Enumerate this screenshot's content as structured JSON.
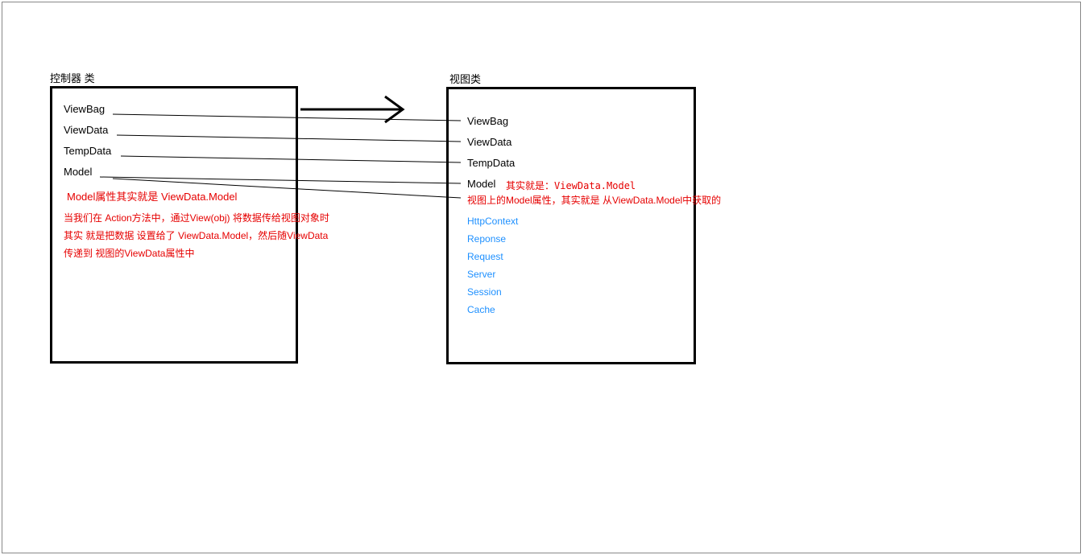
{
  "left": {
    "title": "控制器 类",
    "items": [
      "ViewBag",
      "ViewData",
      "TempData",
      "Model"
    ],
    "note1": "Model属性其实就是 ViewData.Model",
    "note2": "当我们在 Action方法中，通过View(obj)   将数据传给视图对象时",
    "note3": "其实 就是把数据 设置给了 ViewData.Model，然后随ViewData",
    "note4": "传递到 视图的ViewData属性中"
  },
  "right": {
    "title": "视图类",
    "items": [
      "ViewBag",
      "ViewData",
      "TempData",
      "Model"
    ],
    "model_note": "其实就是：ViewData.Model",
    "note1": "视图上的Model属性，其实就是 从ViewData.Model中获取的",
    "blue_items": [
      "HttpContext",
      "Reponse",
      "Request",
      "Server",
      "Session",
      "Cache"
    ]
  }
}
